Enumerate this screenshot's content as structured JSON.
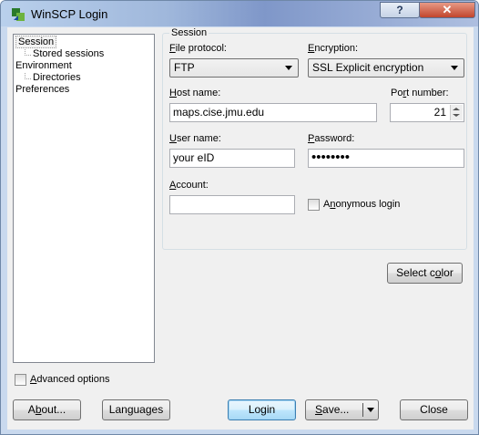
{
  "window": {
    "title": "WinSCP Login",
    "help_label": "?",
    "close_label": "✕"
  },
  "tree": {
    "session": "Session",
    "stored_sessions": "Stored sessions",
    "environment": "Environment",
    "directories": "Directories",
    "preferences": "Preferences"
  },
  "session": {
    "group_title": "Session",
    "file_protocol_label": "File protocol:",
    "file_protocol_value": "FTP",
    "encryption_label": "Encryption:",
    "encryption_value": "SSL Explicit encryption",
    "host_label": "Host name:",
    "host_value": "maps.cise.jmu.edu",
    "port_label": "Port number:",
    "port_value": "21",
    "user_label": "User name:",
    "user_value": "your eID",
    "password_label": "Password:",
    "password_value": "••••••••",
    "account_label": "Account:",
    "account_value": "",
    "anonymous_label": "Anonymous login",
    "select_color_label": "Select color"
  },
  "advanced_label": "Advanced options",
  "buttons": {
    "about": "About...",
    "languages": "Languages",
    "login": "Login",
    "save": "Save...",
    "close": "Close"
  },
  "colors": {
    "accent": "#3c7fb1",
    "title_gradient": "#9fb7db",
    "close_red": "#c2452c"
  }
}
